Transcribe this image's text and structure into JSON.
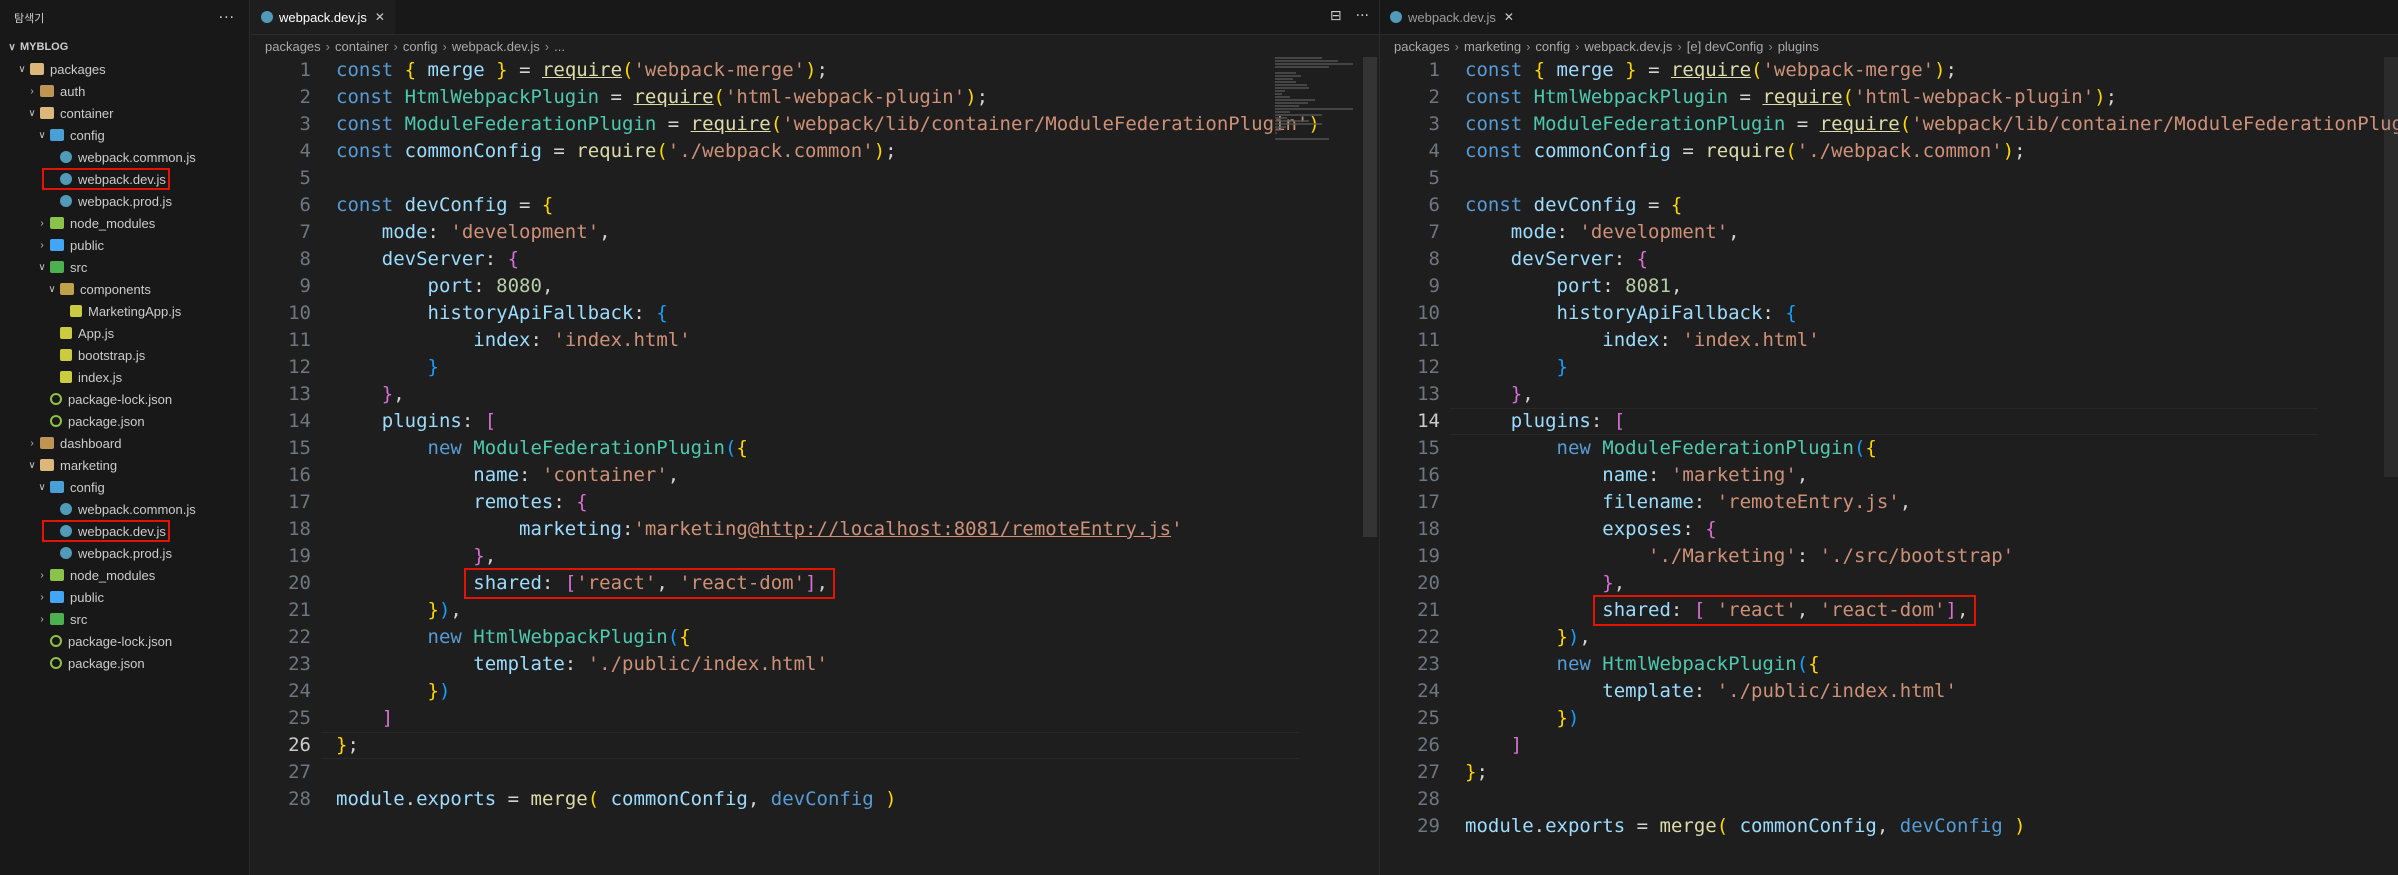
{
  "sidebar": {
    "title": "탐색기",
    "more": "···",
    "tree": [
      {
        "label": "MYBLOG",
        "depth": 0,
        "chev": "∨",
        "icon": "",
        "root": true
      },
      {
        "label": "packages",
        "depth": 1,
        "chev": "∨",
        "icon": "folder-open"
      },
      {
        "label": "auth",
        "depth": 2,
        "chev": "›",
        "icon": "folder"
      },
      {
        "label": "container",
        "depth": 2,
        "chev": "∨",
        "icon": "folder-open"
      },
      {
        "label": "config",
        "depth": 3,
        "chev": "∨",
        "icon": "folder-cfg"
      },
      {
        "label": "webpack.common.js",
        "depth": 4,
        "chev": "",
        "icon": "file-cfg"
      },
      {
        "label": "webpack.dev.js",
        "depth": 4,
        "chev": "",
        "icon": "file-cfg",
        "boxed": true
      },
      {
        "label": "webpack.prod.js",
        "depth": 4,
        "chev": "",
        "icon": "file-cfg"
      },
      {
        "label": "node_modules",
        "depth": 3,
        "chev": "›",
        "icon": "folder-node"
      },
      {
        "label": "public",
        "depth": 3,
        "chev": "›",
        "icon": "folder-pub"
      },
      {
        "label": "src",
        "depth": 3,
        "chev": "∨",
        "icon": "folder-src"
      },
      {
        "label": "components",
        "depth": 4,
        "chev": "∨",
        "icon": "folder-comp"
      },
      {
        "label": "MarketingApp.js",
        "depth": 5,
        "chev": "",
        "icon": "file-react"
      },
      {
        "label": "App.js",
        "depth": 4,
        "chev": "",
        "icon": "file-react"
      },
      {
        "label": "bootstrap.js",
        "depth": 4,
        "chev": "",
        "icon": "file-js"
      },
      {
        "label": "index.js",
        "depth": 4,
        "chev": "",
        "icon": "file-js"
      },
      {
        "label": "package-lock.json",
        "depth": 3,
        "chev": "",
        "icon": "file-json"
      },
      {
        "label": "package.json",
        "depth": 3,
        "chev": "",
        "icon": "file-json"
      },
      {
        "label": "dashboard",
        "depth": 2,
        "chev": "›",
        "icon": "folder"
      },
      {
        "label": "marketing",
        "depth": 2,
        "chev": "∨",
        "icon": "folder-open"
      },
      {
        "label": "config",
        "depth": 3,
        "chev": "∨",
        "icon": "folder-cfg"
      },
      {
        "label": "webpack.common.js",
        "depth": 4,
        "chev": "",
        "icon": "file-cfg"
      },
      {
        "label": "webpack.dev.js",
        "depth": 4,
        "chev": "",
        "icon": "file-cfg",
        "boxed": true
      },
      {
        "label": "webpack.prod.js",
        "depth": 4,
        "chev": "",
        "icon": "file-cfg"
      },
      {
        "label": "node_modules",
        "depth": 3,
        "chev": "›",
        "icon": "folder-node"
      },
      {
        "label": "public",
        "depth": 3,
        "chev": "›",
        "icon": "folder-pub"
      },
      {
        "label": "src",
        "depth": 3,
        "chev": "›",
        "icon": "folder-src"
      },
      {
        "label": "package-lock.json",
        "depth": 3,
        "chev": "",
        "icon": "file-json"
      },
      {
        "label": "package.json",
        "depth": 3,
        "chev": "",
        "icon": "file-json"
      }
    ]
  },
  "left_editor": {
    "tab_label": "webpack.dev.js",
    "tab_close": "✕",
    "actions": [
      "⊟",
      "···"
    ],
    "breadcrumb": [
      "packages",
      "container",
      "config",
      "webpack.dev.js",
      "..."
    ],
    "active_line": 26,
    "boxed_line": 20,
    "lines": [
      [
        [
          "k",
          "const "
        ],
        [
          "b1",
          "{ "
        ],
        [
          "v",
          "merge "
        ],
        [
          "b1",
          "} "
        ],
        [
          "p",
          "= "
        ],
        [
          "f u",
          "require"
        ],
        [
          "b1",
          "("
        ],
        [
          "s",
          "'webpack-merge'"
        ],
        [
          "b1",
          ")"
        ],
        [
          "p",
          ";"
        ]
      ],
      [
        [
          "k",
          "const "
        ],
        [
          "c",
          "HtmlWebpackPlugin "
        ],
        [
          "p",
          "= "
        ],
        [
          "f u",
          "require"
        ],
        [
          "b1",
          "("
        ],
        [
          "s",
          "'html-webpack-plugin'"
        ],
        [
          "b1",
          ")"
        ],
        [
          "p",
          ";"
        ]
      ],
      [
        [
          "k",
          "const "
        ],
        [
          "c",
          "ModuleFederationPlugin "
        ],
        [
          "p",
          "= "
        ],
        [
          "f u",
          "require"
        ],
        [
          "b1",
          "("
        ],
        [
          "s",
          "'webpack/lib/container/ModuleFederationPlugin'"
        ],
        [
          "b1",
          ")"
        ]
      ],
      [
        [
          "k",
          "const "
        ],
        [
          "v",
          "commonConfig "
        ],
        [
          "p",
          "= "
        ],
        [
          "f",
          "require"
        ],
        [
          "b1",
          "("
        ],
        [
          "s",
          "'./webpack.common'"
        ],
        [
          "b1",
          ")"
        ],
        [
          "p",
          ";"
        ]
      ],
      [],
      [
        [
          "k",
          "const "
        ],
        [
          "v",
          "devConfig "
        ],
        [
          "p",
          "= "
        ],
        [
          "b1",
          "{"
        ]
      ],
      [
        [
          "p",
          "    "
        ],
        [
          "v",
          "mode"
        ],
        [
          "p",
          ": "
        ],
        [
          "s",
          "'development'"
        ],
        [
          "p",
          ","
        ]
      ],
      [
        [
          "p",
          "    "
        ],
        [
          "v",
          "devServer"
        ],
        [
          "p",
          ": "
        ],
        [
          "b2",
          "{"
        ]
      ],
      [
        [
          "p",
          "        "
        ],
        [
          "v",
          "port"
        ],
        [
          "p",
          ": "
        ],
        [
          "n",
          "8080"
        ],
        [
          "p",
          ","
        ]
      ],
      [
        [
          "p",
          "        "
        ],
        [
          "v",
          "historyApiFallback"
        ],
        [
          "p",
          ": "
        ],
        [
          "b3",
          "{"
        ]
      ],
      [
        [
          "p",
          "            "
        ],
        [
          "v",
          "index"
        ],
        [
          "p",
          ": "
        ],
        [
          "s",
          "'index.html'"
        ]
      ],
      [
        [
          "p",
          "        "
        ],
        [
          "b3",
          "}"
        ]
      ],
      [
        [
          "p",
          "    "
        ],
        [
          "b2",
          "}"
        ],
        [
          "p",
          ","
        ]
      ],
      [
        [
          "p",
          "    "
        ],
        [
          "v",
          "plugins"
        ],
        [
          "p",
          ": "
        ],
        [
          "b2",
          "["
        ]
      ],
      [
        [
          "p",
          "        "
        ],
        [
          "k",
          "new "
        ],
        [
          "c",
          "ModuleFederationPlugin"
        ],
        [
          "b3",
          "("
        ],
        [
          "b1",
          "{"
        ]
      ],
      [
        [
          "p",
          "            "
        ],
        [
          "v",
          "name"
        ],
        [
          "p",
          ": "
        ],
        [
          "s",
          "'container'"
        ],
        [
          "p",
          ","
        ]
      ],
      [
        [
          "p",
          "            "
        ],
        [
          "v",
          "remotes"
        ],
        [
          "p",
          ": "
        ],
        [
          "b2",
          "{"
        ]
      ],
      [
        [
          "p",
          "                "
        ],
        [
          "v",
          "marketing"
        ],
        [
          "p",
          ":"
        ],
        [
          "s",
          "'marketing@"
        ],
        [
          "s u",
          "http://localhost:8081/remoteEntry.js"
        ],
        [
          "s",
          "'"
        ]
      ],
      [
        [
          "p",
          "            "
        ],
        [
          "b2",
          "}"
        ],
        [
          "p",
          ","
        ]
      ],
      [
        [
          "p",
          "            "
        ],
        [
          "v",
          "shared"
        ],
        [
          "p",
          ": "
        ],
        [
          "b2",
          "["
        ],
        [
          "s",
          "'react'"
        ],
        [
          "p",
          ", "
        ],
        [
          "s",
          "'react-dom'"
        ],
        [
          "b2",
          "]"
        ],
        [
          "p",
          ","
        ]
      ],
      [
        [
          "p",
          "        "
        ],
        [
          "b1",
          "}"
        ],
        [
          "b3",
          ")"
        ],
        [
          "p",
          ","
        ]
      ],
      [
        [
          "p",
          "        "
        ],
        [
          "k",
          "new "
        ],
        [
          "c",
          "HtmlWebpackPlugin"
        ],
        [
          "b3",
          "("
        ],
        [
          "b1",
          "{"
        ]
      ],
      [
        [
          "p",
          "            "
        ],
        [
          "v",
          "template"
        ],
        [
          "p",
          ": "
        ],
        [
          "s",
          "'./public/index.html'"
        ]
      ],
      [
        [
          "p",
          "        "
        ],
        [
          "b1",
          "}"
        ],
        [
          "b3",
          ")"
        ]
      ],
      [
        [
          "p",
          "    "
        ],
        [
          "b2",
          "]"
        ]
      ],
      [
        [
          "b1",
          "}"
        ],
        [
          "p",
          ";"
        ]
      ],
      [],
      [
        [
          "v",
          "module"
        ],
        [
          "p",
          "."
        ],
        [
          "v",
          "exports "
        ],
        [
          "p",
          "= "
        ],
        [
          "f",
          "merge"
        ],
        [
          "b1",
          "( "
        ],
        [
          "v",
          "commonConfig"
        ],
        [
          "p",
          ", "
        ],
        [
          "k",
          "devConfig "
        ],
        [
          "b1",
          ")"
        ]
      ]
    ]
  },
  "right_editor": {
    "tab_label": "webpack.dev.js",
    "tab_close": "✕",
    "breadcrumb": [
      "packages",
      "marketing",
      "config",
      "webpack.dev.js",
      "[e] devConfig",
      "plugins"
    ],
    "active_line": 14,
    "boxed_line": 21,
    "lines": [
      [
        [
          "k",
          "const "
        ],
        [
          "b1",
          "{ "
        ],
        [
          "v",
          "merge "
        ],
        [
          "b1",
          "} "
        ],
        [
          "p",
          "= "
        ],
        [
          "f u",
          "require"
        ],
        [
          "b1",
          "("
        ],
        [
          "s",
          "'webpack-merge'"
        ],
        [
          "b1",
          ")"
        ],
        [
          "p",
          ";"
        ]
      ],
      [
        [
          "k",
          "const "
        ],
        [
          "c",
          "HtmlWebpackPlugin "
        ],
        [
          "p",
          "= "
        ],
        [
          "f u",
          "require"
        ],
        [
          "b1",
          "("
        ],
        [
          "s",
          "'html-webpack-plugin'"
        ],
        [
          "b1",
          ")"
        ],
        [
          "p",
          ";"
        ]
      ],
      [
        [
          "k",
          "const "
        ],
        [
          "c",
          "ModuleFederationPlugin "
        ],
        [
          "p",
          "= "
        ],
        [
          "f u",
          "require"
        ],
        [
          "b1",
          "("
        ],
        [
          "s",
          "'webpack/lib/container/ModuleFederationPlugin'"
        ],
        [
          "b1",
          ")"
        ]
      ],
      [
        [
          "k",
          "const "
        ],
        [
          "v",
          "commonConfig "
        ],
        [
          "p",
          "= "
        ],
        [
          "f",
          "require"
        ],
        [
          "b1",
          "("
        ],
        [
          "s",
          "'./webpack.common'"
        ],
        [
          "b1",
          ")"
        ],
        [
          "p",
          ";"
        ]
      ],
      [],
      [
        [
          "k",
          "const "
        ],
        [
          "v",
          "devConfig "
        ],
        [
          "p",
          "= "
        ],
        [
          "b1",
          "{"
        ]
      ],
      [
        [
          "p",
          "    "
        ],
        [
          "v",
          "mode"
        ],
        [
          "p",
          ": "
        ],
        [
          "s",
          "'development'"
        ],
        [
          "p",
          ","
        ]
      ],
      [
        [
          "p",
          "    "
        ],
        [
          "v",
          "devServer"
        ],
        [
          "p",
          ": "
        ],
        [
          "b2",
          "{"
        ]
      ],
      [
        [
          "p",
          "        "
        ],
        [
          "v",
          "port"
        ],
        [
          "p",
          ": "
        ],
        [
          "n",
          "8081"
        ],
        [
          "p",
          ","
        ]
      ],
      [
        [
          "p",
          "        "
        ],
        [
          "v",
          "historyApiFallback"
        ],
        [
          "p",
          ": "
        ],
        [
          "b3",
          "{"
        ]
      ],
      [
        [
          "p",
          "            "
        ],
        [
          "v",
          "index"
        ],
        [
          "p",
          ": "
        ],
        [
          "s",
          "'index.html'"
        ]
      ],
      [
        [
          "p",
          "        "
        ],
        [
          "b3",
          "}"
        ]
      ],
      [
        [
          "p",
          "    "
        ],
        [
          "b2",
          "}"
        ],
        [
          "p",
          ","
        ]
      ],
      [
        [
          "p",
          "    "
        ],
        [
          "v",
          "plugins"
        ],
        [
          "p",
          ": "
        ],
        [
          "b2",
          "["
        ]
      ],
      [
        [
          "p",
          "        "
        ],
        [
          "k",
          "new "
        ],
        [
          "c",
          "ModuleFederationPlugin"
        ],
        [
          "b3",
          "("
        ],
        [
          "b1",
          "{"
        ]
      ],
      [
        [
          "p",
          "            "
        ],
        [
          "v",
          "name"
        ],
        [
          "p",
          ": "
        ],
        [
          "s",
          "'marketing'"
        ],
        [
          "p",
          ","
        ]
      ],
      [
        [
          "p",
          "            "
        ],
        [
          "v",
          "filename"
        ],
        [
          "p",
          ": "
        ],
        [
          "s",
          "'remoteEntry.js'"
        ],
        [
          "p",
          ","
        ]
      ],
      [
        [
          "p",
          "            "
        ],
        [
          "v",
          "exposes"
        ],
        [
          "p",
          ": "
        ],
        [
          "b2",
          "{"
        ]
      ],
      [
        [
          "p",
          "                "
        ],
        [
          "s",
          "'./Marketing'"
        ],
        [
          "p",
          ": "
        ],
        [
          "s",
          "'./src/bootstrap'"
        ]
      ],
      [
        [
          "p",
          "            "
        ],
        [
          "b2",
          "}"
        ],
        [
          "p",
          ","
        ]
      ],
      [
        [
          "p",
          "            "
        ],
        [
          "v",
          "shared"
        ],
        [
          "p",
          ": "
        ],
        [
          "b2",
          "[ "
        ],
        [
          "s",
          "'react'"
        ],
        [
          "p",
          ", "
        ],
        [
          "s",
          "'react-dom'"
        ],
        [
          "b2",
          "]"
        ],
        [
          "p",
          ","
        ]
      ],
      [
        [
          "p",
          "        "
        ],
        [
          "b1",
          "}"
        ],
        [
          "b3",
          ")"
        ],
        [
          "p",
          ","
        ]
      ],
      [
        [
          "p",
          "        "
        ],
        [
          "k",
          "new "
        ],
        [
          "c",
          "HtmlWebpackPlugin"
        ],
        [
          "b3",
          "("
        ],
        [
          "b1",
          "{"
        ]
      ],
      [
        [
          "p",
          "            "
        ],
        [
          "v",
          "template"
        ],
        [
          "p",
          ": "
        ],
        [
          "s",
          "'./public/index.html'"
        ]
      ],
      [
        [
          "p",
          "        "
        ],
        [
          "b1",
          "}"
        ],
        [
          "b3",
          ")"
        ]
      ],
      [
        [
          "p",
          "    "
        ],
        [
          "b2",
          "]"
        ]
      ],
      [
        [
          "b1",
          "}"
        ],
        [
          "p",
          ";"
        ]
      ],
      [],
      [
        [
          "v",
          "module"
        ],
        [
          "p",
          "."
        ],
        [
          "v",
          "exports "
        ],
        [
          "p",
          "= "
        ],
        [
          "f",
          "merge"
        ],
        [
          "b1",
          "( "
        ],
        [
          "v",
          "commonConfig"
        ],
        [
          "p",
          ", "
        ],
        [
          "k",
          "devConfig "
        ],
        [
          "b1",
          ")"
        ]
      ]
    ]
  },
  "colors": {
    "highlight_box": "#e51400",
    "accent": "#0078d4"
  }
}
